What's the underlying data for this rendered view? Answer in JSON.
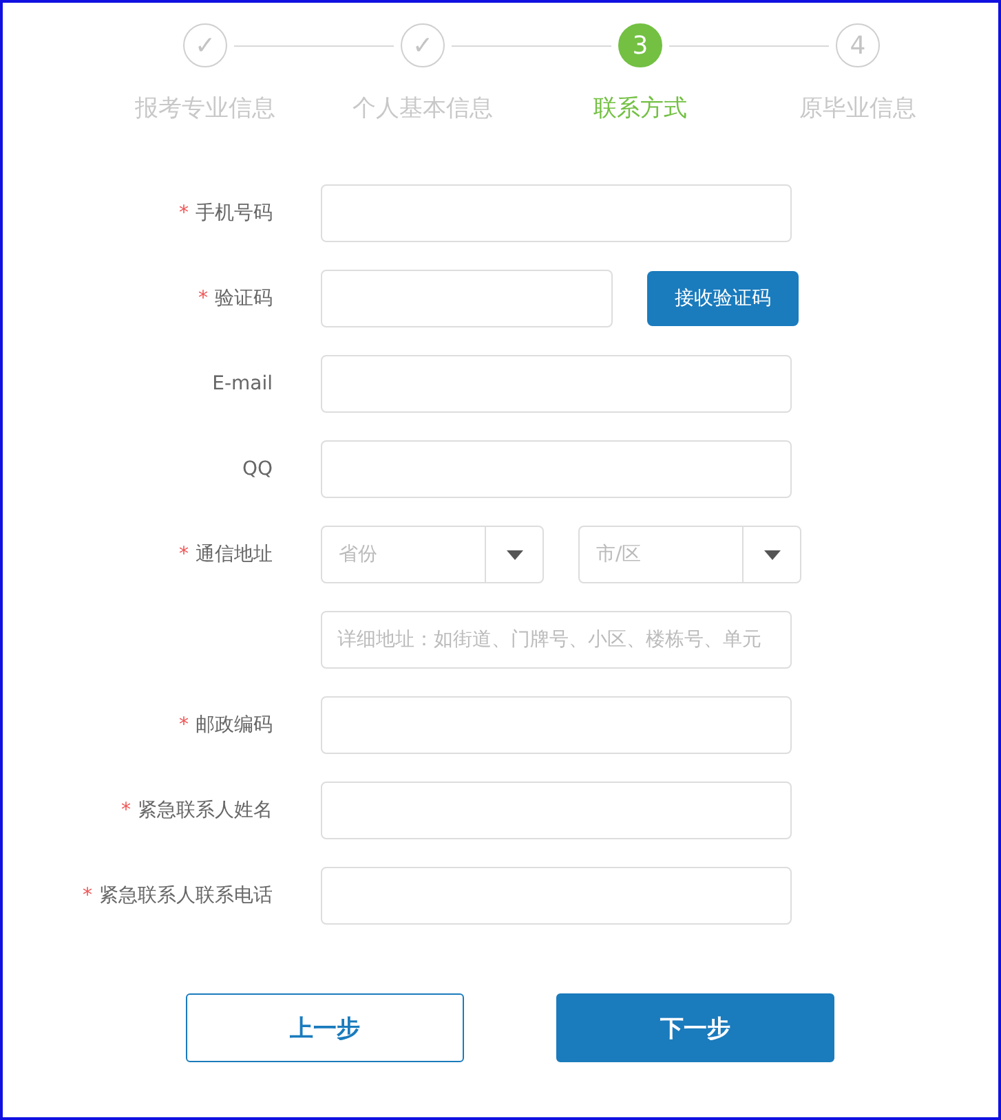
{
  "steps": [
    {
      "mark": "✓",
      "label": "报考专业信息",
      "selected": false
    },
    {
      "mark": "✓",
      "label": "个人基本信息",
      "selected": false
    },
    {
      "mark": "3",
      "label": "联系方式",
      "selected": true
    },
    {
      "mark": "4",
      "label": "原毕业信息",
      "selected": false
    }
  ],
  "rows": [
    {
      "kind": "input",
      "marker": "*",
      "label": "手机号码"
    },
    {
      "kind": "code",
      "marker": "*",
      "label": "验证码",
      "button": "接收验证码"
    },
    {
      "kind": "input",
      "label": "E-mail"
    },
    {
      "kind": "input",
      "label": "QQ"
    },
    {
      "kind": "selects",
      "marker": "*",
      "label": "通信地址",
      "selects": [
        {
          "placeholder": "省份"
        },
        {
          "placeholder": "市/区"
        }
      ]
    },
    {
      "kind": "input",
      "placeholder": "详细地址：如街道、门牌号、小区、楼栋号、单元"
    },
    {
      "kind": "input",
      "marker": "*",
      "label": "邮政编码"
    },
    {
      "kind": "input",
      "marker": "*",
      "label": "紧急联系人姓名"
    },
    {
      "kind": "input",
      "marker": "*",
      "label": "紧急联系人联系电话"
    }
  ],
  "buttons": [
    {
      "label": "上一步",
      "kind": "secondary"
    },
    {
      "label": "下一步",
      "kind": "primary"
    }
  ]
}
